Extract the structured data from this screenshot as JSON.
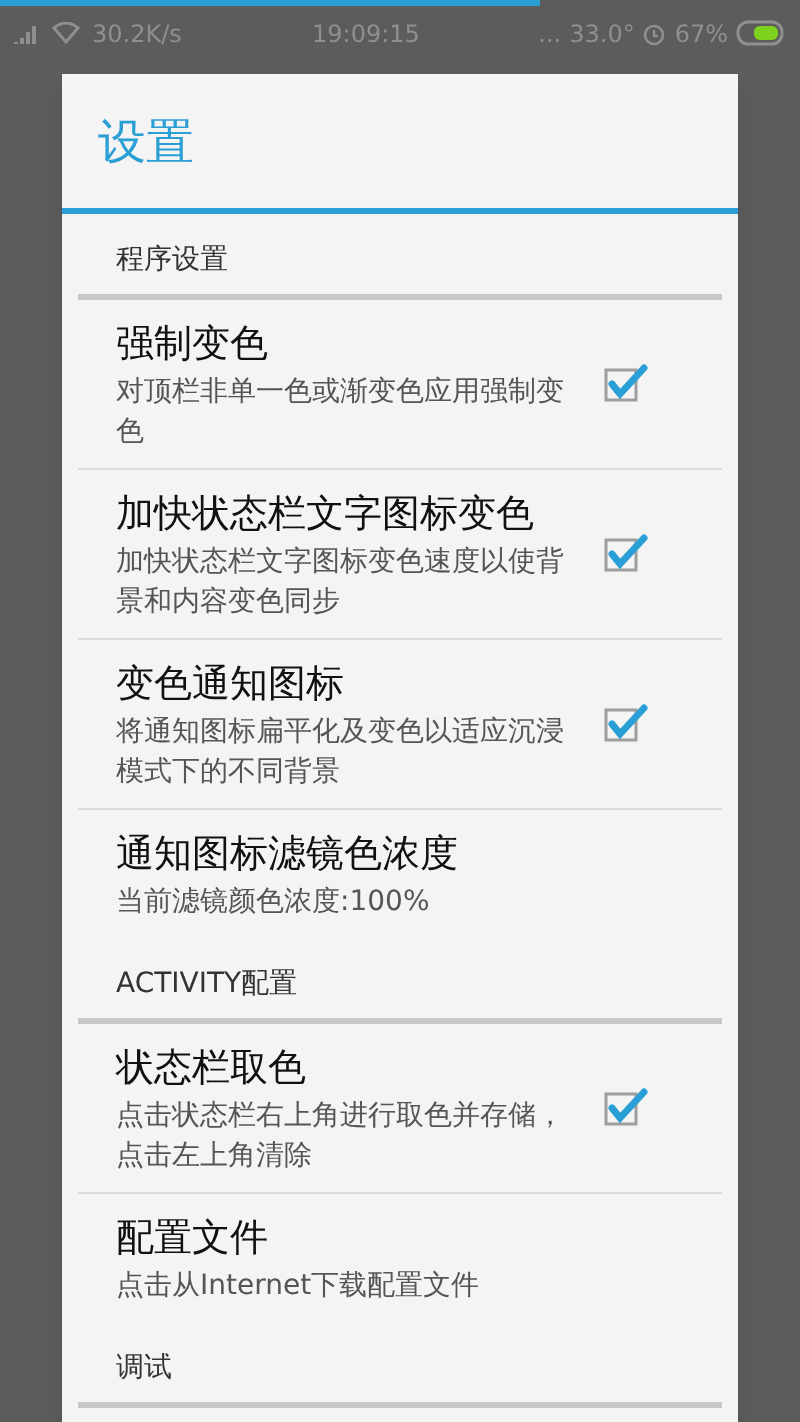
{
  "status_bar": {
    "speed": "30.2K/s",
    "time": "19:09:15",
    "dots": "...",
    "temperature": "33.0°",
    "battery": "67%"
  },
  "dialog": {
    "title": "设置",
    "sections": [
      {
        "title": "程序设置",
        "items": [
          {
            "kind": "checkbox",
            "title": "强制变色",
            "summary": "对顶栏非单一色或渐变色应用强制变色",
            "checked": true
          },
          {
            "kind": "checkbox",
            "title": "加快状态栏文字图标变色",
            "summary": "加快状态栏文字图标变色速度以使背景和内容变色同步",
            "checked": true
          },
          {
            "kind": "checkbox",
            "title": "变色通知图标",
            "summary": "将通知图标扁平化及变色以适应沉浸模式下的不同背景",
            "checked": true
          },
          {
            "kind": "plain",
            "title": "通知图标滤镜色浓度",
            "summary": "当前滤镜颜色浓度:100%"
          }
        ]
      },
      {
        "title": "ACTIVITY配置",
        "items": [
          {
            "kind": "checkbox",
            "title": "状态栏取色",
            "summary": "点击状态栏右上角进行取色并存储，点击左上角清除",
            "checked": true
          },
          {
            "kind": "plain",
            "title": "配置文件",
            "summary": "点击从Internet下载配置文件"
          }
        ]
      },
      {
        "title": "调试"
      }
    ]
  }
}
